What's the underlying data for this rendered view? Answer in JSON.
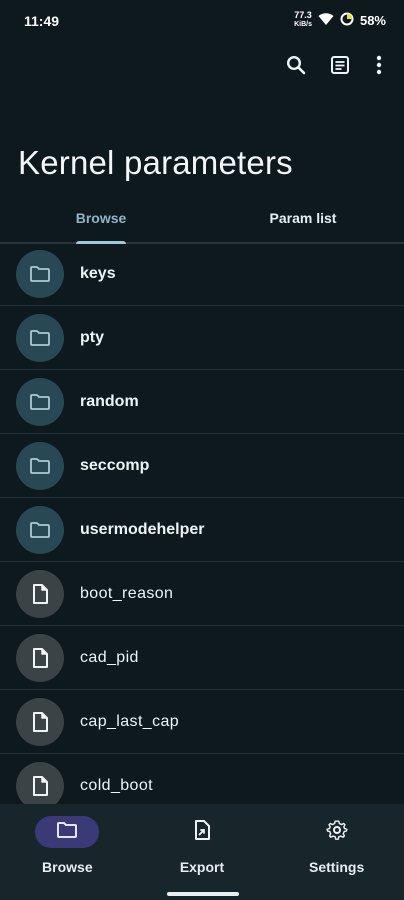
{
  "status": {
    "time": "11:49",
    "net_speed_top": "77.3",
    "net_speed_bottom": "KiB/s",
    "battery": "58%"
  },
  "toolbar": {
    "search_icon": "search-icon",
    "list_icon": "list-icon",
    "more_icon": "more-vert-icon"
  },
  "page": {
    "title": "Kernel parameters"
  },
  "tabs": [
    {
      "label": "Browse",
      "active": true
    },
    {
      "label": "Param list",
      "active": false
    }
  ],
  "items": [
    {
      "label": "keys",
      "type": "folder"
    },
    {
      "label": "pty",
      "type": "folder"
    },
    {
      "label": "random",
      "type": "folder"
    },
    {
      "label": "seccomp",
      "type": "folder"
    },
    {
      "label": "usermodehelper",
      "type": "folder"
    },
    {
      "label": "boot_reason",
      "type": "file"
    },
    {
      "label": "cad_pid",
      "type": "file"
    },
    {
      "label": "cap_last_cap",
      "type": "file"
    },
    {
      "label": "cold_boot",
      "type": "file"
    }
  ],
  "nav": [
    {
      "label": "Browse",
      "icon": "folder-icon",
      "active": true
    },
    {
      "label": "Export",
      "icon": "export-file-icon",
      "active": false
    },
    {
      "label": "Settings",
      "icon": "gear-icon",
      "active": false
    }
  ],
  "colors": {
    "background": "#0e191e",
    "accent": "#8fb5c6",
    "folder_circle": "#284854",
    "file_circle": "#3b4346",
    "nav_active_pill": "#3a3a78"
  }
}
